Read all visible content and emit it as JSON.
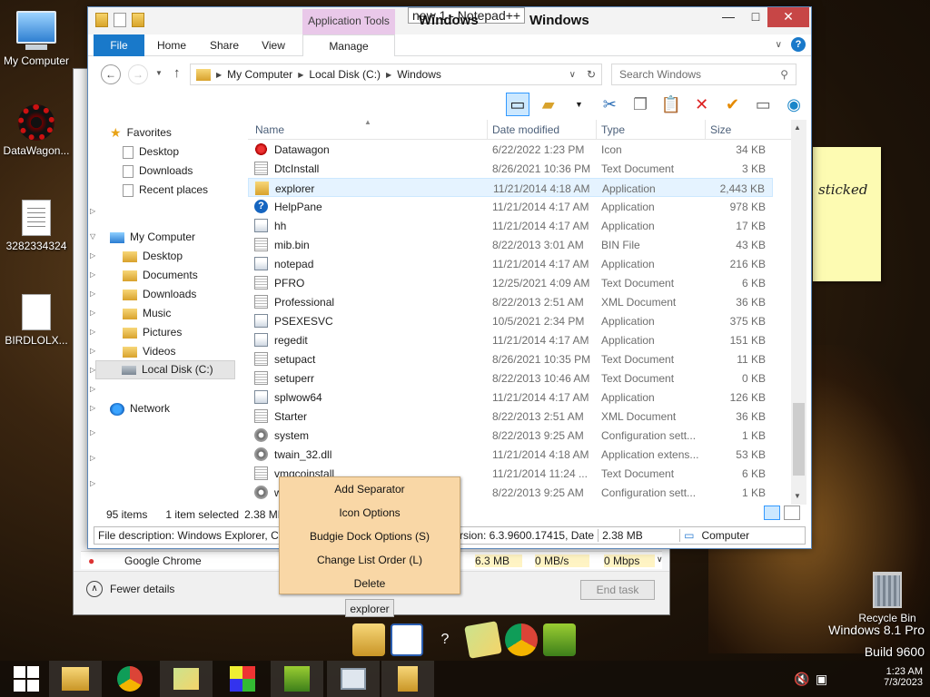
{
  "desktop": {
    "icons": [
      {
        "label": "My Computer"
      },
      {
        "label": "DataWagon..."
      },
      {
        "label": "3282334324"
      },
      {
        "label": "BIRDLOLX..."
      }
    ],
    "sticky_text": "sticked",
    "recycle_label": "Recycle Bin",
    "watermark_line1": "Windows 8.1 Pro",
    "watermark_line2": "Build 9600"
  },
  "taskmgr": {
    "row": {
      "name": "Google Chrome",
      "memory": "6.3 MB",
      "disk": "0 MB/s",
      "network": "0 Mbps"
    },
    "fewer_details": "Fewer details",
    "end_task": "End task"
  },
  "explorer": {
    "app_tools": "Application Tools",
    "overlay_title": "new 1 - Notepad++",
    "title": "Windows",
    "title_suffix": "Windows",
    "ribbon": {
      "file": "File",
      "home": "Home",
      "share": "Share",
      "view": "View",
      "manage": "Manage"
    },
    "address": {
      "crumbs": [
        "My Computer",
        "Local Disk (C:)",
        "Windows"
      ]
    },
    "search_placeholder": "Search Windows",
    "nav": {
      "favorites": "Favorites",
      "fav_items": [
        "Desktop",
        "Downloads",
        "Recent places"
      ],
      "mycomputer": "My Computer",
      "pc_items": [
        "Desktop",
        "Documents",
        "Downloads",
        "Music",
        "Pictures",
        "Videos",
        "Local Disk (C:)"
      ],
      "network": "Network"
    },
    "columns": {
      "name": "Name",
      "date": "Date modified",
      "type": "Type",
      "size": "Size"
    },
    "files": [
      {
        "name": "Datawagon",
        "date": "6/22/2022 1:23 PM",
        "type": "Icon",
        "size": "34 KB",
        "icon": "red"
      },
      {
        "name": "DtcInstall",
        "date": "8/26/2021 10:36 PM",
        "type": "Text Document",
        "size": "3 KB",
        "icon": "txt"
      },
      {
        "name": "explorer",
        "date": "11/21/2014 4:18 AM",
        "type": "Application",
        "size": "2,443 KB",
        "icon": "folder"
      },
      {
        "name": "HelpPane",
        "date": "11/21/2014 4:17 AM",
        "type": "Application",
        "size": "978 KB",
        "icon": "help"
      },
      {
        "name": "hh",
        "date": "11/21/2014 4:17 AM",
        "type": "Application",
        "size": "17 KB",
        "icon": "app"
      },
      {
        "name": "mib.bin",
        "date": "8/22/2013 3:01 AM",
        "type": "BIN File",
        "size": "43 KB",
        "icon": "txt"
      },
      {
        "name": "notepad",
        "date": "11/21/2014 4:17 AM",
        "type": "Application",
        "size": "216 KB",
        "icon": "app"
      },
      {
        "name": "PFRO",
        "date": "12/25/2021 4:09 AM",
        "type": "Text Document",
        "size": "6 KB",
        "icon": "txt"
      },
      {
        "name": "Professional",
        "date": "8/22/2013 2:51 AM",
        "type": "XML Document",
        "size": "36 KB",
        "icon": "txt"
      },
      {
        "name": "PSEXESVC",
        "date": "10/5/2021 2:34 PM",
        "type": "Application",
        "size": "375 KB",
        "icon": "app"
      },
      {
        "name": "regedit",
        "date": "11/21/2014 4:17 AM",
        "type": "Application",
        "size": "151 KB",
        "icon": "app"
      },
      {
        "name": "setupact",
        "date": "8/26/2021 10:35 PM",
        "type": "Text Document",
        "size": "11 KB",
        "icon": "txt"
      },
      {
        "name": "setuperr",
        "date": "8/22/2013 10:46 AM",
        "type": "Text Document",
        "size": "0 KB",
        "icon": "txt"
      },
      {
        "name": "splwow64",
        "date": "11/21/2014 4:17 AM",
        "type": "Application",
        "size": "126 KB",
        "icon": "app"
      },
      {
        "name": "Starter",
        "date": "8/22/2013 2:51 AM",
        "type": "XML Document",
        "size": "36 KB",
        "icon": "txt"
      },
      {
        "name": "system",
        "date": "8/22/2013 9:25 AM",
        "type": "Configuration sett...",
        "size": "1 KB",
        "icon": "gear"
      },
      {
        "name": "twain_32.dll",
        "date": "11/21/2014 4:18 AM",
        "type": "Application extens...",
        "size": "53 KB",
        "icon": "gear"
      },
      {
        "name": "vmgcoinstall",
        "date": "11/21/2014 11:24 ...",
        "type": "Text Document",
        "size": "6 KB",
        "icon": "txt"
      },
      {
        "name": "w",
        "date": "8/22/2013 9:25 AM",
        "type": "Configuration sett...",
        "size": "1 KB",
        "icon": "gear"
      }
    ],
    "status": {
      "count": "95 items",
      "selected": "1 item selected",
      "size": "2.38 MB"
    },
    "info": {
      "desc": "File description: Windows Explorer, Co",
      "version": "rsion: 6.3.9600.17415, Date",
      "size": "2.38 MB",
      "location": "Computer"
    }
  },
  "context_menu": [
    "Add Separator",
    "Icon Options",
    "Budgie Dock Options (S)",
    "Change List Order (L)",
    "Delete"
  ],
  "dock": {
    "label": "explorer",
    "help_glyph": "?"
  },
  "tray": {
    "time": "1:23 AM",
    "date": "7/3/2023"
  }
}
